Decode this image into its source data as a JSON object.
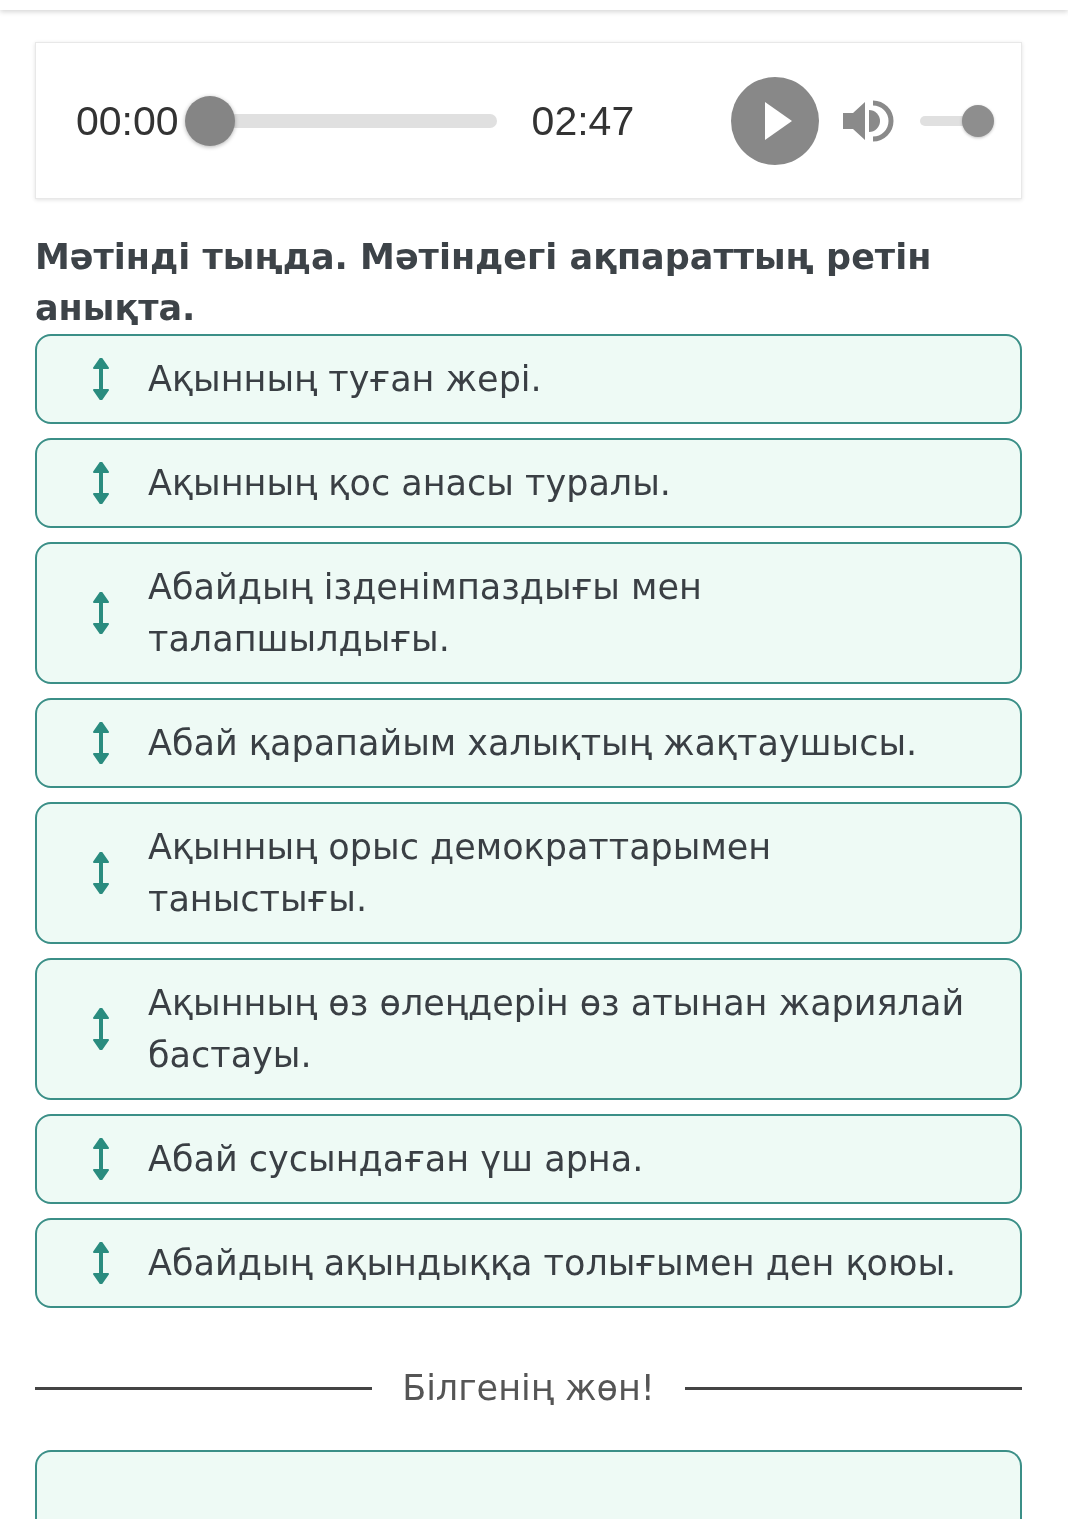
{
  "audio_player": {
    "current_time": "00:00",
    "seek": {
      "level": 0
    },
    "duration": "02:47",
    "playing": false,
    "muted": false,
    "volume": {
      "level": 1
    }
  },
  "instruction": "Мәтінді тыңда. Мәтіндегі ақпараттың ретін анықта.",
  "items": [
    {
      "text": "Ақынның туған жері."
    },
    {
      "text": "Ақынның қос анасы туралы."
    },
    {
      "text": "Абайдың ізденімпаздығы мен талапшылдығы."
    },
    {
      "text": "Абай қарапайым халықтың жақтаушысы."
    },
    {
      "text": "Ақынның орыс демократтарымен таныстығы."
    },
    {
      "text": "Ақынның өз өлеңдерін өз атынан жариялай бастауы."
    },
    {
      "text": "Абай сусындаған үш арна."
    },
    {
      "text": "Абайдың ақындыққа толығымен ден қоюы."
    }
  ],
  "section_title": "Білгенің жөн!"
}
